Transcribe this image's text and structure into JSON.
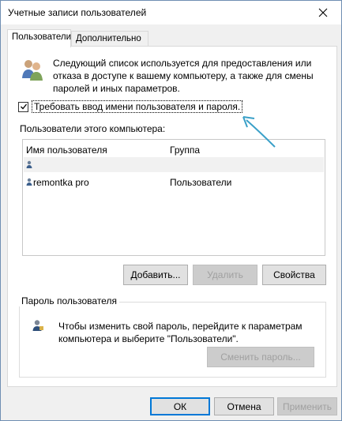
{
  "window": {
    "title": "Учетные записи пользователей",
    "close_icon": "close-icon"
  },
  "tabs": [
    {
      "label": "Пользователи",
      "active": true
    },
    {
      "label": "Дополнительно",
      "active": false
    }
  ],
  "users_tab": {
    "icon": "users-icon",
    "description": "Следующий список используется для предоставления или отказа в доступе к вашему компьютеру, а также для смены паролей и иных параметров.",
    "require_login": {
      "label": "Требовать ввод имени пользователя и пароля.",
      "checked": true
    },
    "users_list_title": "Пользователи этого компьютера:",
    "table": {
      "headers": [
        "Имя пользователя",
        "Группа"
      ],
      "rows": [
        {
          "name": "",
          "group": ""
        },
        {
          "name": "remontka pro",
          "group": "Пользователи"
        }
      ]
    },
    "buttons": {
      "add": "Добавить...",
      "remove": "Удалить",
      "properties": "Свойства"
    },
    "password_group": {
      "title": "Пароль пользователя",
      "icon": "user-password-icon",
      "text": "Чтобы изменить свой пароль, перейдите к параметрам компьютера и выберите \"Пользователи\".",
      "change_button": "Сменить пароль..."
    }
  },
  "footer": {
    "ok": "ОК",
    "cancel": "Отмена",
    "apply": "Применить"
  },
  "colors": {
    "accent": "#0078d7",
    "annotation_arrow": "#3aa0c8"
  }
}
